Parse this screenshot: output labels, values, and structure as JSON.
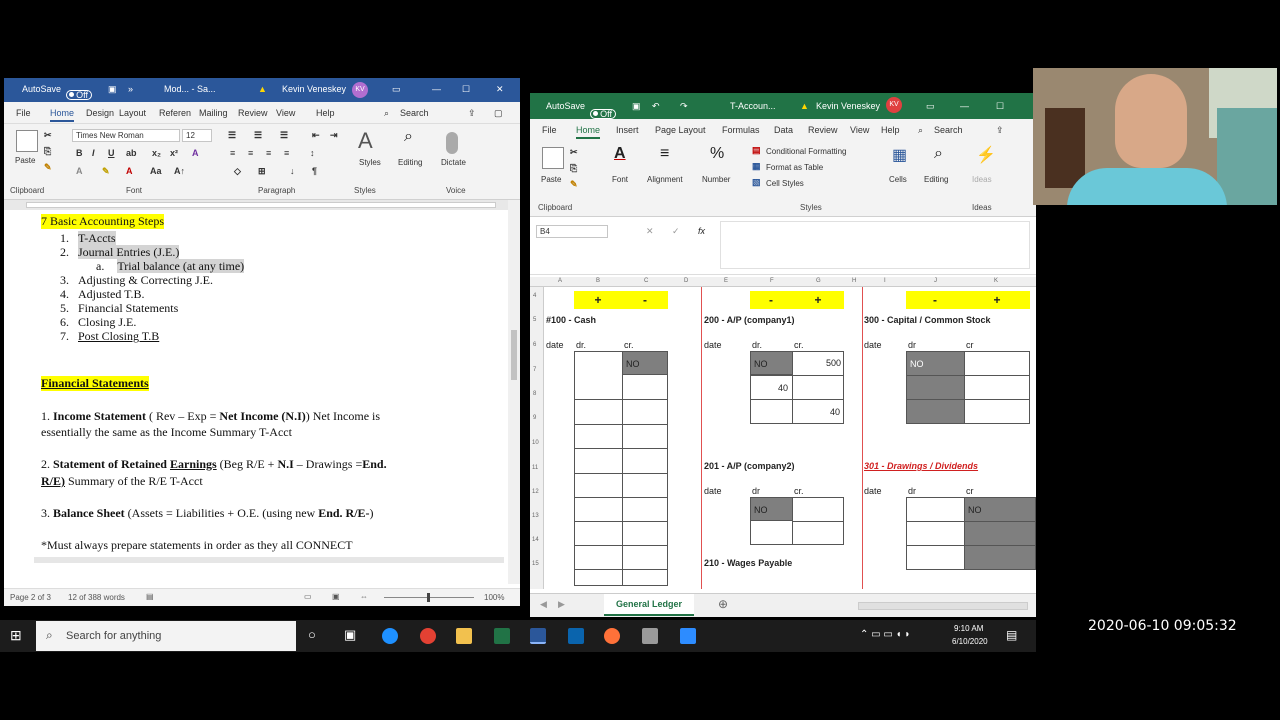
{
  "word": {
    "titlebar": {
      "autosave_label": "AutoSave",
      "autosave_state": "Off",
      "doc_title": "Mod... - Sa...",
      "user": "Kevin Veneskey",
      "initials": "KV"
    },
    "tabs": [
      "File",
      "Home",
      "Design",
      "Layout",
      "Referen",
      "Mailing",
      "Review",
      "View",
      "Help"
    ],
    "active_tab": "Home",
    "search_label": "Search",
    "font_name": "Times New Roman",
    "font_size": "12",
    "groups": {
      "clipboard": "Clipboard",
      "font": "Font",
      "paragraph": "Paragraph",
      "styles": "Styles",
      "voice": "Voice"
    },
    "buttons": {
      "paste": "Paste",
      "styles": "Styles",
      "editing": "Editing",
      "dictate": "Dictate"
    },
    "doc": {
      "heading1": "7 Basic Accounting Steps",
      "steps": [
        {
          "num": "1.",
          "text": "T-Accts"
        },
        {
          "num": "2.",
          "text": "Journal Entries (J.E.)"
        },
        {
          "num": "a.",
          "text": "Trial balance (at any time)"
        },
        {
          "num": "3.",
          "text": "Adjusting & Correcting J.E."
        },
        {
          "num": "4.",
          "text": "Adjusted T.B."
        },
        {
          "num": "5.",
          "text": "Financial Statements"
        },
        {
          "num": "6.",
          "text": "Closing J.E."
        },
        {
          "num": "7.",
          "text": "Post Closing T.B"
        }
      ],
      "heading2": "Financial Statements",
      "is": {
        "prefix": "1. ",
        "bold": "Income Statement",
        "formula": " ( Rev – Exp = ",
        "ni": "Net Income (N.I)",
        "tail": ")   Net Income is",
        "line2": "essentially the same as the Income Summary T-Acct"
      },
      "re": {
        "prefix": "2.  ",
        "bold": "Statement of Retained ",
        "earn": "Earnings",
        "formula": "  (Beg R/E + ",
        "ni": "N.I",
        "tail": " – Drawings =",
        "end": "End.",
        "line2a": "R/E)",
        "line2b": "   Summary of the R/E T-Acct"
      },
      "bs": {
        "prefix": "3.  ",
        "bold": "Balance Sheet",
        "formula": "  (Assets = Liabilities + O.E. (using new ",
        "end": "End. R/E-",
        ")": ")"
      },
      "note": "*Must always prepare statements in order as they all CONNECT"
    },
    "status": {
      "page": "Page 2 of 3",
      "words": "12 of 388 words",
      "zoom": "100%"
    }
  },
  "excel": {
    "titlebar": {
      "autosave_label": "AutoSave",
      "autosave_state": "Off",
      "doc_title": "T-Accoun...",
      "user": "Kevin Veneskey",
      "initials": "KV"
    },
    "tabs": [
      "File",
      "Home",
      "Insert",
      "Page Layout",
      "Formulas",
      "Data",
      "Review",
      "View",
      "Help"
    ],
    "active_tab": "Home",
    "search_label": "Search",
    "ribbon": {
      "paste": "Paste",
      "font": "Font",
      "alignment": "Alignment",
      "number": "Number",
      "cond_format": "Conditional Formatting",
      "format_table": "Format as Table",
      "cell_styles": "Cell Styles",
      "cells": "Cells",
      "editing": "Editing",
      "ideas": "Ideas",
      "g_clipboard": "Clipboard",
      "g_styles": "Styles",
      "g_ideas": "Ideas"
    },
    "name_box": "B4",
    "columns": [
      "A",
      "B",
      "C",
      "D",
      "E",
      "F",
      "G",
      "H",
      "I",
      "J",
      "K"
    ],
    "rows": [
      "4",
      "5",
      "6",
      "7",
      "8",
      "9",
      "10",
      "11",
      "12",
      "13",
      "14",
      "15"
    ],
    "accounts": {
      "cash": {
        "title": "#100 - Cash",
        "plus": "+",
        "minus": "-",
        "date": "date",
        "dr": "dr.",
        "cr": "cr.",
        "no": "NO"
      },
      "ap1": {
        "title": "200 - A/P (company1)",
        "minus": "-",
        "plus": "+",
        "date": "date",
        "dr": "dr.",
        "cr": "cr.",
        "no": "NO",
        "cr1": "500",
        "dr2": "40",
        "cr3": "40"
      },
      "cap": {
        "title": "300 - Capital / Common Stock",
        "minus": "-",
        "plus": "+",
        "date": "date",
        "dr": "dr",
        "cr": "cr",
        "no": "NO"
      },
      "ap2": {
        "title": "201 - A/P (company2)",
        "date": "date",
        "dr": "dr",
        "cr": "cr.",
        "no": "NO"
      },
      "draw": {
        "title": "301 - Drawings / Dividends",
        "date": "date",
        "dr": "dr",
        "cr": "cr",
        "no": "NO"
      },
      "wages": {
        "title": "210 - Wages Payable"
      }
    },
    "sheet_tab": "General Ledger"
  },
  "taskbar": {
    "search_placeholder": "Search for anything",
    "time": "9:10 AM",
    "date": "6/10/2020"
  },
  "timestamp": "2020-06-10 09:05:32",
  "colors": {
    "word_blue": "#2b579a",
    "excel_green": "#217346",
    "highlight": "#ffff00",
    "gray_cell": "#7f7f7f",
    "red_text": "#d02020"
  }
}
